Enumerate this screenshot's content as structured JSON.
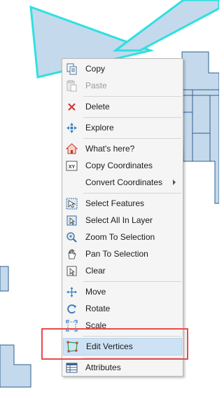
{
  "context_menu": {
    "items": [
      {
        "label": "Copy",
        "icon": "copy-icon",
        "enabled": true
      },
      {
        "label": "Paste",
        "icon": "paste-icon",
        "enabled": false
      },
      {
        "label": "Delete",
        "icon": "delete-icon",
        "enabled": true
      },
      {
        "label": "Explore",
        "icon": "explore-icon",
        "enabled": true
      },
      {
        "label": "What's here?",
        "icon": "whats-here-icon",
        "enabled": true
      },
      {
        "label": "Copy Coordinates",
        "icon": "copy-coordinates-icon",
        "enabled": true
      },
      {
        "label": "Convert Coordinates",
        "icon": "",
        "enabled": true,
        "submenu": true
      },
      {
        "label": "Select Features",
        "icon": "select-features-icon",
        "enabled": true
      },
      {
        "label": "Select All In Layer",
        "icon": "select-all-in-layer-icon",
        "enabled": true
      },
      {
        "label": "Zoom To Selection",
        "icon": "zoom-to-selection-icon",
        "enabled": true
      },
      {
        "label": "Pan To Selection",
        "icon": "pan-to-selection-icon",
        "enabled": true
      },
      {
        "label": "Clear",
        "icon": "clear-selection-icon",
        "enabled": true
      },
      {
        "label": "Move",
        "icon": "move-icon",
        "enabled": true
      },
      {
        "label": "Rotate",
        "icon": "rotate-icon",
        "enabled": true
      },
      {
        "label": "Scale",
        "icon": "scale-icon",
        "enabled": true
      },
      {
        "label": "Edit Vertices",
        "icon": "edit-vertices-icon",
        "enabled": true,
        "selected": true
      },
      {
        "label": "Attributes",
        "icon": "attributes-icon",
        "enabled": true
      }
    ],
    "copy_icon_glyph": "XY"
  },
  "colors": {
    "feature_fill": "#c5d9ec",
    "feature_stroke": "#2d5f8f",
    "selected_outline": "#2fe0e0",
    "highlight_box": "#e54c4c",
    "menu_selected": "#cde3f5"
  }
}
